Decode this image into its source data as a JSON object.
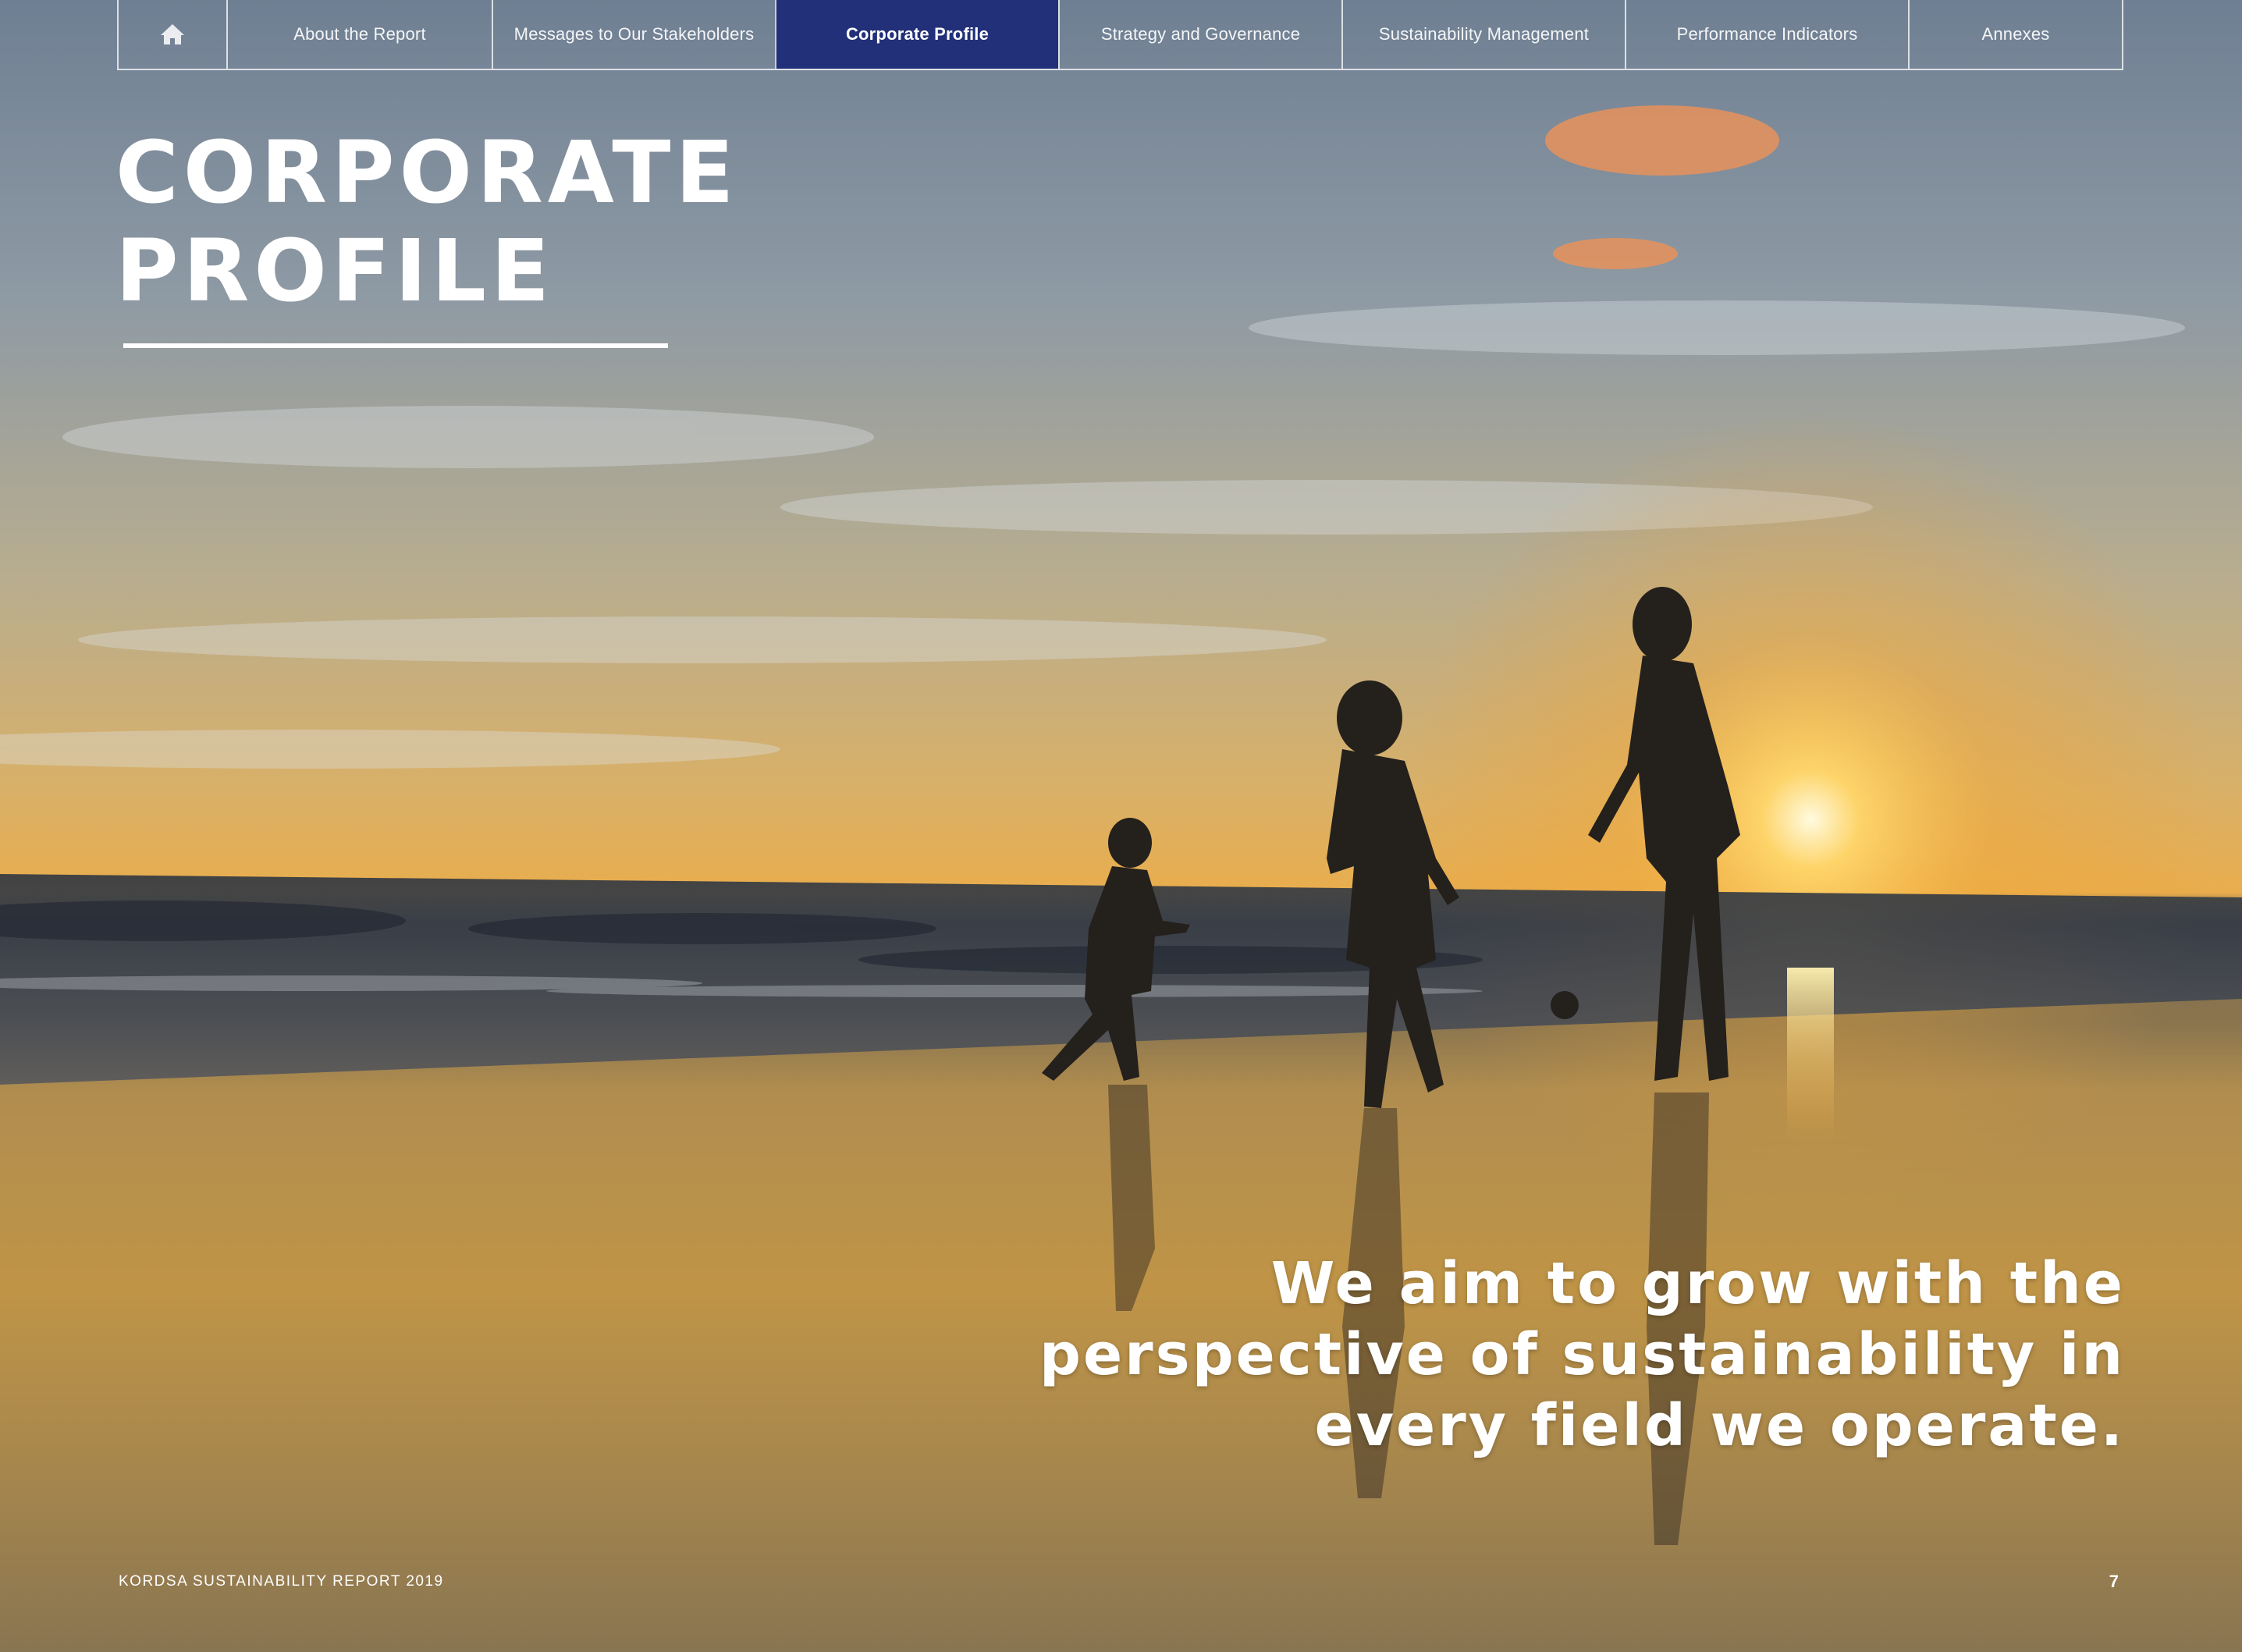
{
  "nav": {
    "home_icon": "home-icon",
    "items": [
      {
        "label": "About the Report"
      },
      {
        "label": "Messages to Our Stakeholders"
      },
      {
        "label": "Corporate Profile",
        "active": true
      },
      {
        "label": "Strategy and Governance"
      },
      {
        "label": "Sustainability Management"
      },
      {
        "label": "Performance Indicators"
      },
      {
        "label": "Annexes"
      }
    ],
    "active_color": "#22307a"
  },
  "title": {
    "line1": "CORPORATE",
    "line2": "PROFILE"
  },
  "quote": {
    "line1": "We aim to grow with the",
    "line2": "perspective of sustainability in",
    "line3": "every field we operate."
  },
  "footer": {
    "report_name": "KORDSA SUSTAINABILITY REPORT 2019",
    "page_number": "7"
  }
}
